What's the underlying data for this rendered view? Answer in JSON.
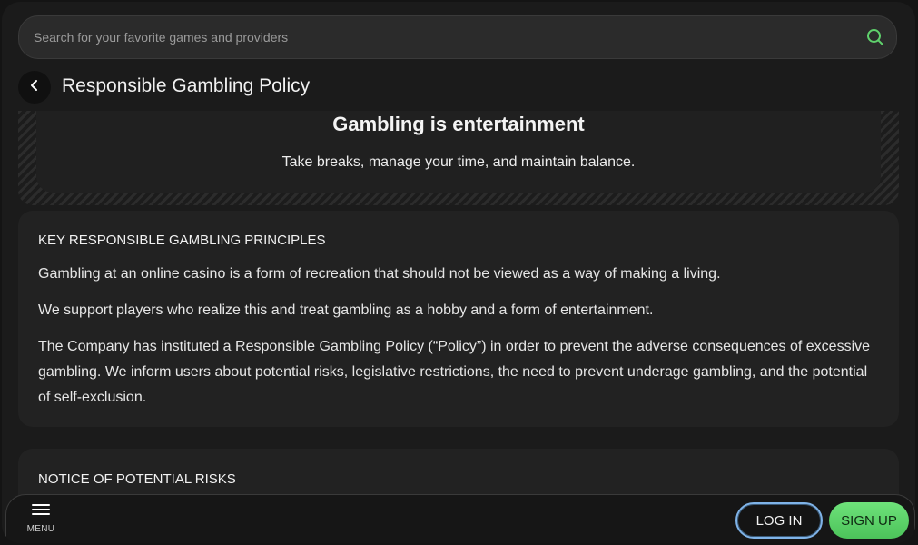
{
  "search": {
    "placeholder": "Search for your favorite games and providers"
  },
  "header": {
    "title": "Responsible Gambling Policy"
  },
  "banner": {
    "title": "Gambling is entertainment",
    "subtitle": "Take breaks, manage your time, and maintain balance."
  },
  "sections": [
    {
      "heading": "KEY RESPONSIBLE GAMBLING PRINCIPLES",
      "paragraphs": [
        "Gambling at an online casino is a form of recreation that should not be viewed as a way of making a living.",
        "We support players who realize this and treat gambling as a hobby and a form of entertainment.",
        "The Company has instituted a Responsible Gambling Policy (“Policy”) in order to prevent the adverse consequences of excessive gambling. We inform users about potential risks, legislative restrictions, the need to prevent underage gambling, and the potential of self-exclusion."
      ]
    },
    {
      "heading": "NOTICE OF POTENTIAL RISKS"
    }
  ],
  "bottombar": {
    "menu_label": "MENU",
    "login_label": "LOG IN",
    "signup_label": "SIGN UP"
  },
  "colors": {
    "accent_green": "#5fd16c",
    "login_border": "#7fb3e8",
    "background": "#1b1b1b",
    "card": "#222222"
  },
  "icons": {
    "search": "search-icon",
    "back": "chevron-left-icon",
    "menu": "hamburger-menu-icon"
  }
}
